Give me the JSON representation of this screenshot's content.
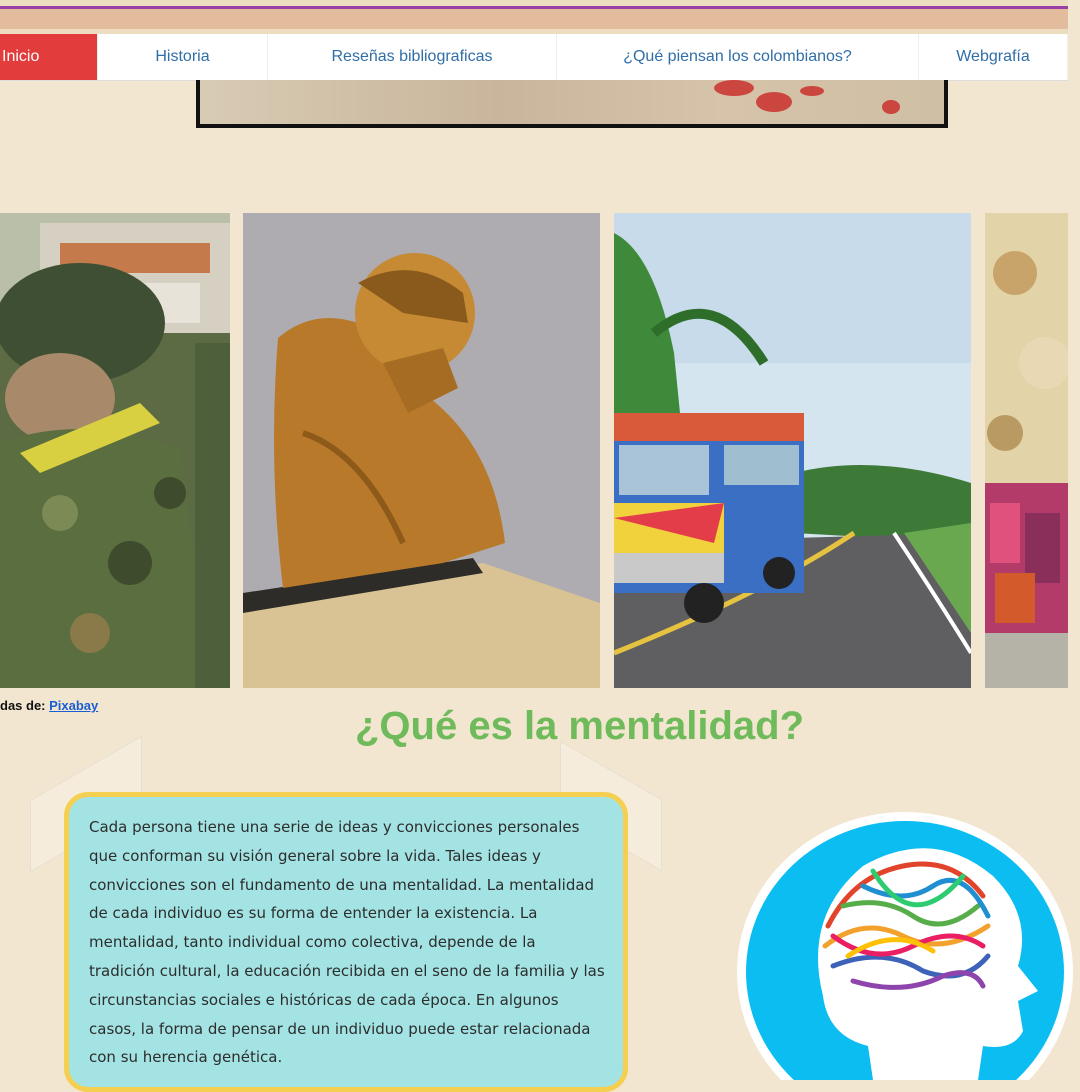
{
  "nav": {
    "items": [
      {
        "label": "Inicio",
        "active": true
      },
      {
        "label": "Historia",
        "active": false
      },
      {
        "label": "Reseñas bibliograficas",
        "active": false
      },
      {
        "label": "¿Qué piensan los colombianos?",
        "active": false
      },
      {
        "label": "Webgrafía",
        "active": false
      }
    ],
    "active_color": "#e33c3c",
    "link_color": "#2f6ea7"
  },
  "gallery": {
    "images": [
      {
        "icon": "soldier-photo"
      },
      {
        "icon": "bronze-bust-photo"
      },
      {
        "icon": "chiva-bus-photo"
      },
      {
        "icon": "market-wall-photo"
      }
    ],
    "credit_prefix": "das de: ",
    "credit_link": "Pixabay"
  },
  "main": {
    "heading": "¿Qué es la mentalidad?",
    "heading_color": "#6fba5a",
    "paragraph": "Cada persona tiene una serie de ideas y convicciones personales que conforman su visión general sobre la vida. Tales ideas y convicciones son el fundamento de una mentalidad.  La mentalidad de cada individuo es su forma de entender la existencia. La mentalidad, tanto individual como colectiva, depende de la tradición cultural, la educación recibida en el seno de la familia y las circunstancias sociales e históricas de cada época. En algunos casos, la forma de pensar de un individuo puede estar relacionada con su herencia genética.",
    "box_color": "#a4e3e3",
    "border_color": "#f5cf50"
  },
  "illustration": {
    "icon": "head-brain-icon",
    "circle_color": "#0cbdf2"
  }
}
